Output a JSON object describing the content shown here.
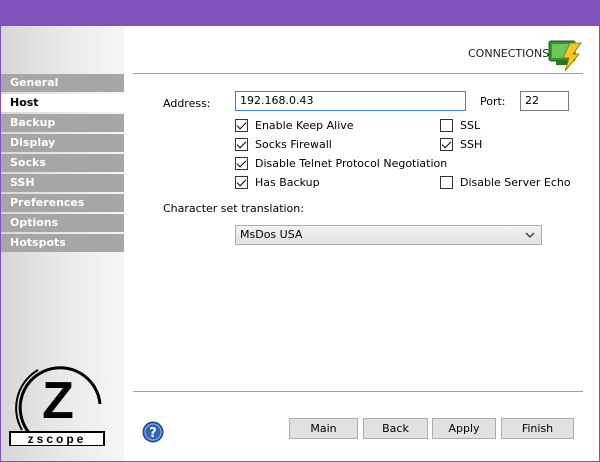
{
  "header": {
    "section_title": "CONNECTIONS"
  },
  "sidebar": {
    "items": [
      {
        "label": "General"
      },
      {
        "label": "Host"
      },
      {
        "label": "Backup"
      },
      {
        "label": "Display"
      },
      {
        "label": "Socks"
      },
      {
        "label": "SSH"
      },
      {
        "label": "Preferences"
      },
      {
        "label": "Options"
      },
      {
        "label": "Hotspots"
      }
    ],
    "active_item": "Host",
    "logo_text": "zscope"
  },
  "form": {
    "address_label": "Address:",
    "address_value": "192.168.0.43",
    "port_label": "Port:",
    "port_value": "22",
    "checkboxes": [
      {
        "label": "Enable Keep Alive",
        "checked": true
      },
      {
        "label": "Socks Firewall",
        "checked": true
      },
      {
        "label": "Disable Telnet Protocol Negotiation",
        "checked": true
      },
      {
        "label": "Has Backup",
        "checked": true
      },
      {
        "label": "SSL",
        "checked": false
      },
      {
        "label": "SSH",
        "checked": true
      },
      {
        "label": "Disable Server Echo",
        "checked": false
      }
    ],
    "charset_label": "Character set translation:",
    "charset_value": "MsDos USA"
  },
  "footer": {
    "main_label": "Main",
    "back_label": "Back",
    "apply_label": "Apply",
    "finish_label": "Finish"
  },
  "colors": {
    "titlebar": "#7e52b8",
    "sidebar_item": "#a6a6a6",
    "sidebar_active": "#ffffff",
    "help_icon": "#2f66b8"
  },
  "icons": [
    "connections-icon",
    "help-icon",
    "chevron-down-icon",
    "checkmark-icon"
  ]
}
